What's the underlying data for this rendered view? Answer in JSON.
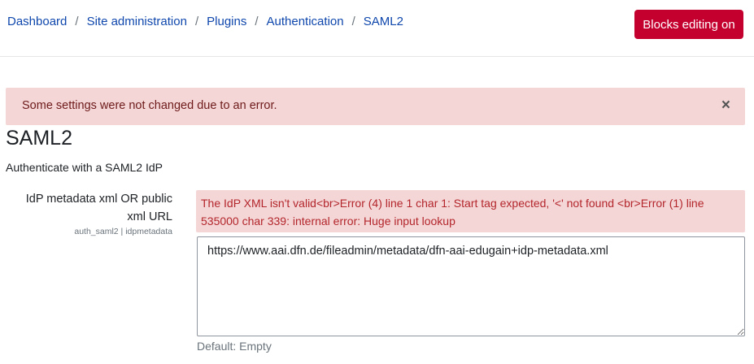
{
  "breadcrumb": {
    "items": [
      "Dashboard",
      "Site administration",
      "Plugins",
      "Authentication",
      "SAML2"
    ],
    "separator": "/"
  },
  "header": {
    "blocks_editing_label": "Blocks editing on",
    "button_color": "#c4002f"
  },
  "alert": {
    "message": "Some settings were not changed due to an error.",
    "close_symbol": "×",
    "close_icon": "close-icon"
  },
  "page": {
    "title": "SAML2",
    "description": "Authenticate with a SAML2 IdP"
  },
  "setting": {
    "label": "IdP metadata xml OR public xml URL",
    "id": "auth_saml2 | idpmetadata",
    "error": "The IdP XML isn't valid<br>Error (4) line 1 char 1: Start tag expected, '<' not found <br>Error (1) line 535000 char 339: internal error: Huge input lookup",
    "value": "https://www.aai.dfn.de/fileadmin/metadata/dfn-aai-edugain+idp-metadata.xml",
    "default": "Default: Empty"
  }
}
